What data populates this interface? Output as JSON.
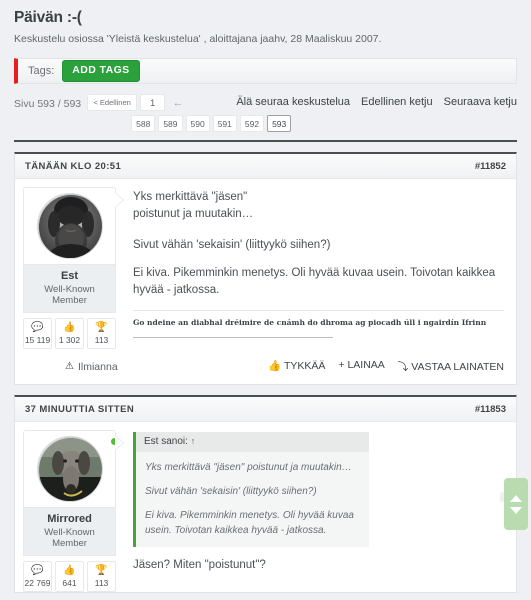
{
  "thread": {
    "title": "Päivän :-(",
    "subtitle": "Keskustelu osiossa 'Yleistä keskustelua' , aloittajana jaahv, 28 Maaliskuu 2007."
  },
  "tags": {
    "label": "Tags:",
    "add_button": "ADD TAGS"
  },
  "pagination": {
    "counter": "Sivu 593 / 593",
    "prev_label": "< Edellinen",
    "first_page": "1",
    "arrow": "←",
    "pages": [
      "588",
      "589",
      "590",
      "591",
      "592",
      "593"
    ],
    "current": "593"
  },
  "nav_links": {
    "unwatch": "Älä seuraa keskustelua",
    "prev_thread": "Edellinen ketju",
    "next_thread": "Seuraava ketju"
  },
  "posts": [
    {
      "date": "TÄNÄÄN KLO 20:51",
      "number": "#11852",
      "user": {
        "name": "Est",
        "title": "Well-Known Member",
        "avatar": "bearded-man-avatar",
        "online": false,
        "stats": [
          {
            "icon": "speech-bubble-icon",
            "value": "15 119"
          },
          {
            "icon": "thumbs-up-icon",
            "value": "1 302"
          },
          {
            "icon": "trophy-icon",
            "value": "113"
          }
        ]
      },
      "message": [
        "Yks merkittävä \"jäsen\"",
        "poistunut ja muutakin…",
        "Sivut vähän 'sekaisin' (liittyykö siihen?)",
        "Ei kiva. Pikemminkin menetys. Oli hyvää kuvaa usein. Toivotan kaikkea hyvää - jatkossa."
      ],
      "signature": "Go ndeine an diabhal dréimire de cnámh do dhroma ag piocadh úll i ngairdín Ifrinn",
      "footer": {
        "report": "Ilmianna",
        "like": "TYKKÄÄ",
        "multiquote": "+ LAINAA",
        "reply_quote": "VASTAA LAINATEN"
      }
    },
    {
      "date": "37 MINUUTTIA SITTEN",
      "number": "#11853",
      "user": {
        "name": "Mirrored",
        "title": "Well-Known Member",
        "avatar": "dog-avatar",
        "online": true,
        "stats": [
          {
            "icon": "speech-bubble-icon",
            "value": "22 769"
          },
          {
            "icon": "thumbs-up-icon",
            "value": "641"
          },
          {
            "icon": "trophy-icon",
            "value": "113"
          }
        ]
      },
      "quote": {
        "attribution": "Est sanoi:",
        "jump": "↑",
        "lines": [
          "Yks merkittävä \"jäsen\" poistunut ja muutakin…",
          "Sivut vähän 'sekaisin' (liittyykö siihen?)",
          "Ei kiva. Pikemminkin menetys. Oli hyvää kuvaa usein. Toivotan kaikkea hyvää - jatkossa."
        ]
      },
      "message": [
        "Jäsen? Miten \"poistunut\"?"
      ]
    }
  ],
  "scroll_widget": {
    "up": "scroll-up-arrow",
    "down": "scroll-down-arrow"
  }
}
